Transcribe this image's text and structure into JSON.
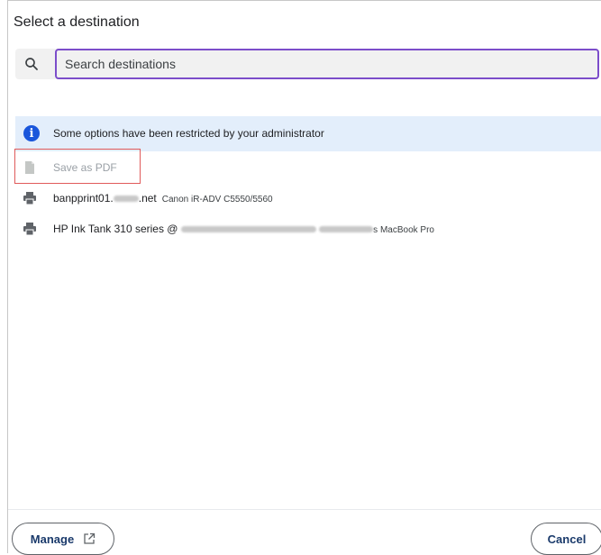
{
  "dialog": {
    "title": "Select a destination"
  },
  "search": {
    "placeholder": "Search destinations"
  },
  "banner": {
    "icon": "info-icon",
    "text": "Some options have been restricted by your administrator"
  },
  "destinations": [
    {
      "icon": "document-icon",
      "name": "Save as PDF",
      "detail": "",
      "disabled": true
    },
    {
      "icon": "printer-icon",
      "name_prefix": "banpprint01.",
      "name_suffix": ".net",
      "detail": "Canon iR-ADV C5550/5560",
      "disabled": false
    },
    {
      "icon": "printer-icon",
      "name_prefix": "HP Ink Tank 310 series @",
      "name_suffix": "",
      "detail": "s MacBook Pro",
      "disabled": false
    }
  ],
  "footer": {
    "manage_label": "Manage",
    "cancel_label": "Cancel"
  },
  "colors": {
    "focus_border": "#7c4dca",
    "banner_bg": "#e3eefb",
    "info_icon": "#1a56db",
    "highlight_box": "#e05a5a",
    "button_text": "#1a3a6b"
  }
}
